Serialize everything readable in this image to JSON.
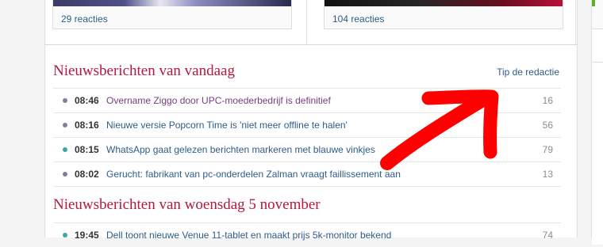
{
  "top_cards": [
    {
      "reacties": "29 reacties"
    },
    {
      "reacties": "104 reacties"
    }
  ],
  "sections": [
    {
      "heading": "Nieuwsberichten van vandaag",
      "tip_link": "Tip de redactie",
      "items": [
        {
          "time": "08:46",
          "title": "Overname Ziggo door UPC-moederbedrijf is definitief",
          "count": "16",
          "bullet": "#8b7a98",
          "visited": true
        },
        {
          "time": "08:16",
          "title": "Nieuwe versie Popcorn Time is 'niet meer offline te halen'",
          "count": "56",
          "bullet": "#8b7a98",
          "visited": false
        },
        {
          "time": "08:15",
          "title": "WhatsApp gaat gelezen berichten markeren met blauwe vinkjes",
          "count": "79",
          "bullet": "#3aa7a2",
          "visited": false
        },
        {
          "time": "08:02",
          "title": "Gerucht: fabrikant van pc-onderdelen Zalman vraagt faillissement aan",
          "count": "13",
          "bullet": "#8b7a98",
          "visited": false
        }
      ]
    },
    {
      "heading": "Nieuwsberichten van woensdag 5 november",
      "items": [
        {
          "time": "19:45",
          "title": "Dell toont nieuwe Venue 11-tablet en maakt prijs 5k-monitor bekend",
          "count": "74",
          "bullet": "#3aa7a2",
          "visited": false
        }
      ]
    }
  ],
  "colors": {
    "heading": "#b7173c",
    "link": "#2d5c88",
    "visited_link": "#7a3b82",
    "annotation_arrow": "#ff0000"
  }
}
